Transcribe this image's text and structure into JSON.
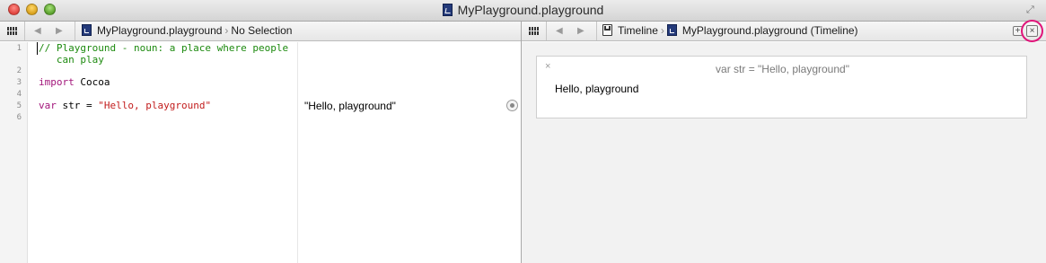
{
  "window": {
    "title": "MyPlayground.playground"
  },
  "left_jumpbar": {
    "file": "MyPlayground.playground",
    "selection": "No Selection"
  },
  "right_jumpbar": {
    "mode": "Timeline",
    "file": "MyPlayground.playground (Timeline)"
  },
  "editor": {
    "line_numbers": [
      "1",
      "2",
      "3",
      "4",
      "5",
      "6"
    ],
    "line1": "// Playground - noun: a place where people",
    "line1_wrap": "   can play",
    "line3_keyword": "import",
    "line3_module": " Cocoa",
    "line5_keyword": "var",
    "line5_plain": " str = ",
    "line5_string": "\"Hello, playground\""
  },
  "results": {
    "line5": "\"Hello, playground\""
  },
  "timeline": {
    "card_close": "×",
    "card_title": "var str = \"Hello, playground\"",
    "card_value": "Hello, playground"
  },
  "colors": {
    "comment": "#1d8a0f",
    "keyword": "#a2157a",
    "string": "#c21c1c",
    "highlight_ring": "#e0157a"
  },
  "icons": {
    "traffic_lights": [
      "close-window-icon",
      "minimize-window-icon",
      "zoom-window-icon"
    ],
    "fullscreen": "fullscreen-icon",
    "related_items": "related-items-grid-icon",
    "nav_back": "back-arrow-icon",
    "nav_forward": "forward-arrow-icon",
    "add_editor": "add-assistant-editor-icon",
    "close_editor": "close-assistant-editor-icon",
    "quick_look": "quick-look-icon"
  }
}
